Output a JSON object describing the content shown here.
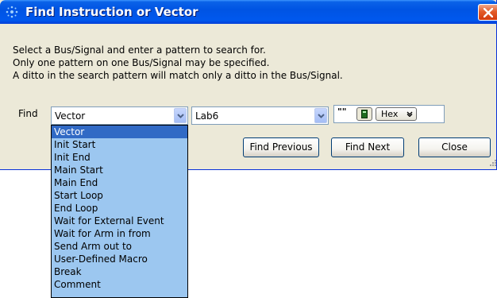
{
  "window": {
    "title": "Find Instruction or Vector",
    "close_glyph": "×"
  },
  "instructions": {
    "line1": "Select a Bus/Signal and enter a pattern to search for.",
    "line2": "Only one pattern on one Bus/Signal may be specified.",
    "line3": "A ditto in the search pattern will match only a ditto in the Bus/Signal."
  },
  "find": {
    "label": "Find",
    "type_value": "Vector",
    "bus_value": "Lab6",
    "pattern_value": "\"\"",
    "base_value": "Hex"
  },
  "buttons": {
    "find_previous": "Find Previous",
    "find_next": "Find Next",
    "close": "Close"
  },
  "dropdown": {
    "selected_index": 0,
    "items": [
      "Vector",
      "Init Start",
      "Init End",
      "Main Start",
      "Main End",
      "Start Loop",
      "End Loop",
      "Wait for External Event",
      "Wait for Arm in from",
      "Send Arm out to",
      "User-Defined Macro",
      "Break",
      "Comment"
    ]
  },
  "icons": {
    "app": "app-sparkle-icon",
    "close": "close-icon",
    "combo_arrow": "chevron-down-icon",
    "calculator": "calculator-icon",
    "grip": "resize-grip-icon"
  },
  "colors": {
    "titlebar": "#0054e3",
    "dialog_bg": "#ece9d8",
    "dropdown_bg": "#9cc7f0",
    "selection": "#316ac5",
    "close_button": "#e35b28"
  }
}
